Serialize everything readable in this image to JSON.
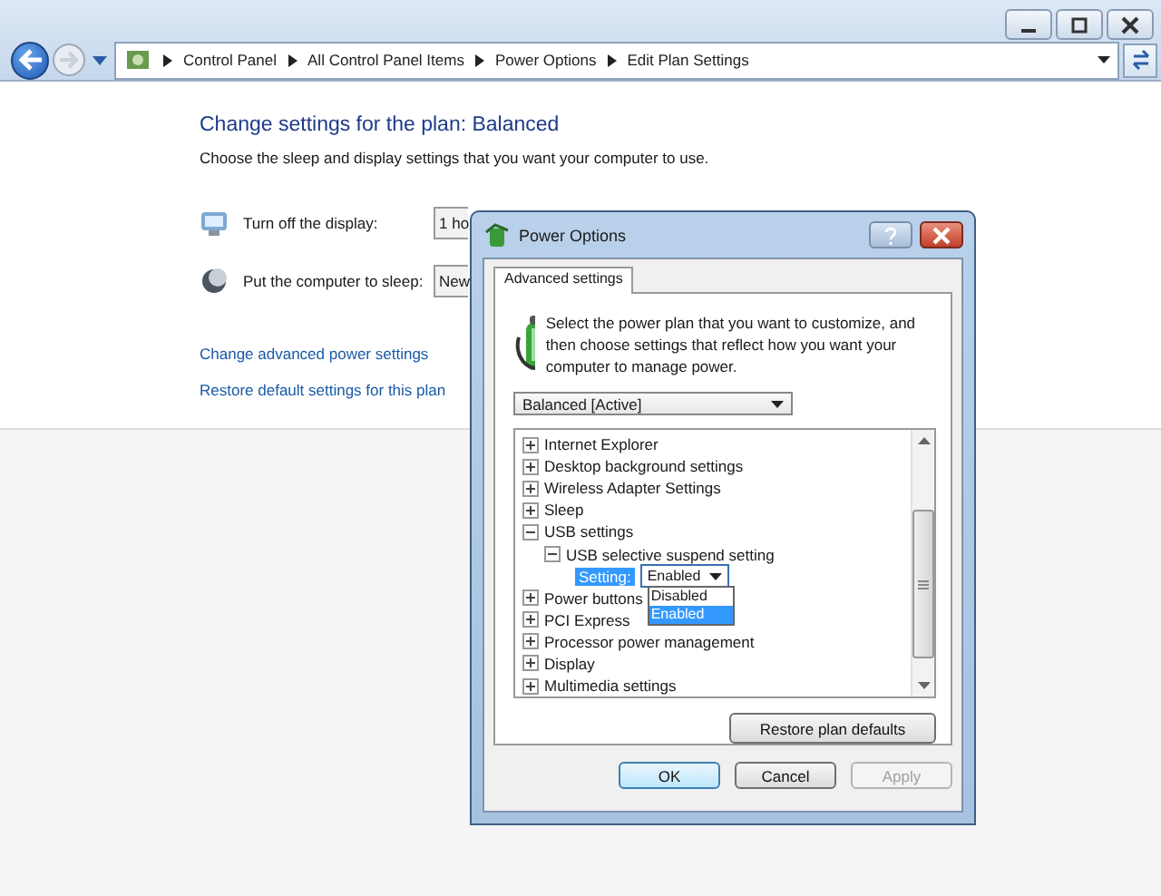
{
  "window": {
    "breadcrumb": [
      "Control Panel",
      "All Control Panel Items",
      "Power Options",
      "Edit Plan Settings"
    ]
  },
  "page": {
    "title": "Change settings for the plan: Balanced",
    "subtitle": "Choose the sleep and display settings that you want your computer to use.",
    "settings": [
      {
        "kind": "display",
        "label": "Turn off the display:",
        "value": "1 ho"
      },
      {
        "kind": "sleep",
        "label": "Put the computer to sleep:",
        "value": "New"
      }
    ],
    "links": [
      "Change advanced power settings",
      "Restore default settings for this plan"
    ]
  },
  "dialog": {
    "title": "Power Options",
    "tabs": [
      {
        "label": "Advanced settings",
        "selected": true
      }
    ],
    "intro": "Select the power plan that you want to customize, and then choose settings that reflect how you want your computer to manage power.",
    "plan": "Balanced [Active]",
    "tree": [
      {
        "label": "Internet Explorer",
        "expanded": false
      },
      {
        "label": "Desktop background settings",
        "expanded": false
      },
      {
        "label": "Wireless Adapter Settings",
        "expanded": false
      },
      {
        "label": "Sleep",
        "expanded": false
      },
      {
        "label": "USB settings",
        "expanded": true,
        "children": [
          {
            "label": "USB selective suspend setting",
            "expanded": true,
            "setting": {
              "label": "Setting:",
              "value": "Enabled",
              "open": true,
              "options": [
                {
                  "label": "Disabled",
                  "selected": false
                },
                {
                  "label": "Enabled",
                  "selected": true
                }
              ]
            }
          }
        ]
      },
      {
        "label": "Power buttons",
        "expanded": false
      },
      {
        "label": "PCI Express",
        "expanded": false
      },
      {
        "label": "Processor power management",
        "expanded": false
      },
      {
        "label": "Display",
        "expanded": false
      },
      {
        "label": "Multimedia settings",
        "expanded": false
      }
    ],
    "restore_button": "Restore plan defaults",
    "buttons": [
      {
        "label": "OK",
        "kind": "default",
        "disabled": false
      },
      {
        "label": "Cancel",
        "kind": "normal",
        "disabled": false
      },
      {
        "label": "Apply",
        "kind": "normal",
        "disabled": true
      }
    ]
  }
}
